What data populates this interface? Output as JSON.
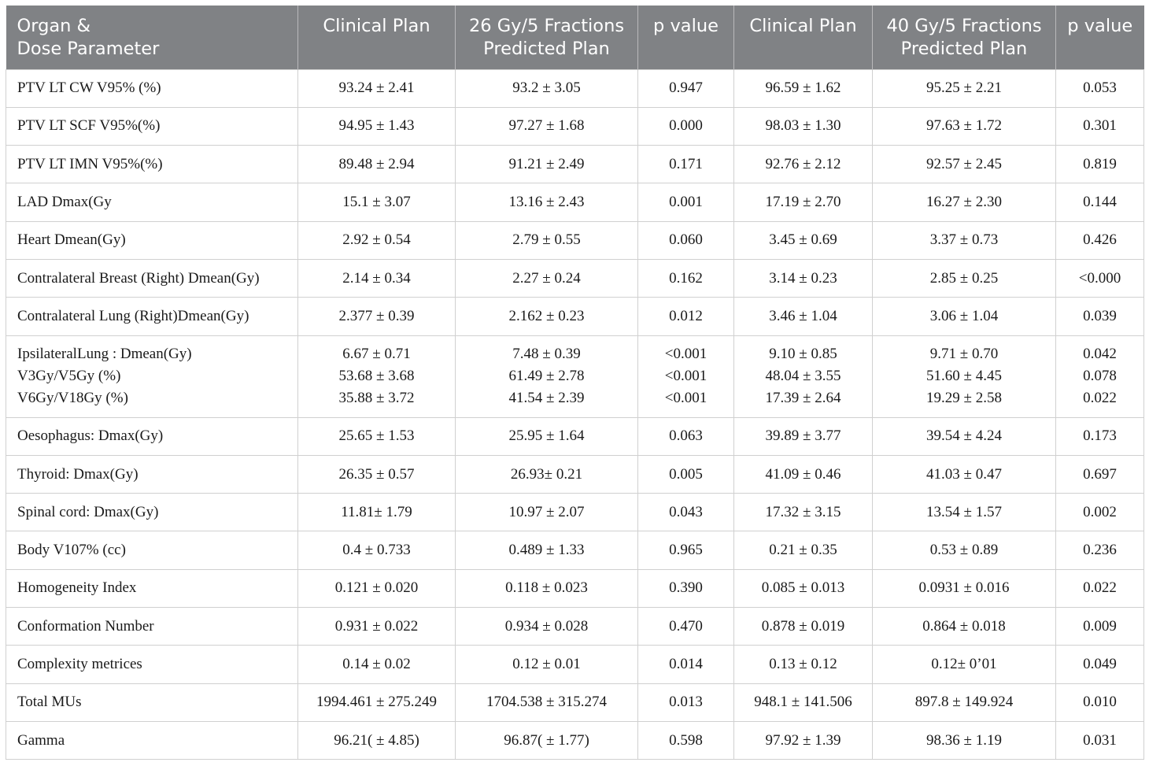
{
  "headers": [
    [
      "Organ &",
      "Dose Parameter"
    ],
    [
      "Clinical Plan"
    ],
    [
      "26 Gy/5 Fractions",
      "Predicted Plan"
    ],
    [
      "p value"
    ],
    [
      "Clinical Plan"
    ],
    [
      "40 Gy/5 Fractions",
      "Predicted Plan"
    ],
    [
      "p value"
    ]
  ],
  "rows": [
    {
      "cells": [
        [
          "PTV LT CW V95% (%)"
        ],
        [
          "93.24 ± 2.41"
        ],
        [
          "93.2 ± 3.05"
        ],
        [
          "0.947"
        ],
        [
          "96.59 ± 1.62"
        ],
        [
          "95.25 ± 2.21"
        ],
        [
          "0.053"
        ]
      ]
    },
    {
      "cells": [
        [
          "PTV LT SCF V95%(%)"
        ],
        [
          "94.95 ± 1.43"
        ],
        [
          "97.27 ± 1.68"
        ],
        [
          "0.000"
        ],
        [
          "98.03 ± 1.30"
        ],
        [
          "97.63 ± 1.72"
        ],
        [
          "0.301"
        ]
      ]
    },
    {
      "cells": [
        [
          "PTV LT IMN V95%(%)"
        ],
        [
          "89.48 ± 2.94"
        ],
        [
          "91.21 ± 2.49"
        ],
        [
          "0.171"
        ],
        [
          "92.76 ± 2.12"
        ],
        [
          "92.57 ± 2.45"
        ],
        [
          "0.819"
        ]
      ]
    },
    {
      "cells": [
        [
          "LAD Dmax(Gy"
        ],
        [
          "15.1 ± 3.07"
        ],
        [
          "13.16 ± 2.43"
        ],
        [
          "0.001"
        ],
        [
          "17.19 ± 2.70"
        ],
        [
          "16.27 ± 2.30"
        ],
        [
          "0.144"
        ]
      ]
    },
    {
      "cells": [
        [
          "Heart Dmean(Gy)"
        ],
        [
          "2.92 ± 0.54"
        ],
        [
          "2.79 ± 0.55"
        ],
        [
          "0.060"
        ],
        [
          "3.45 ± 0.69"
        ],
        [
          "3.37 ± 0.73"
        ],
        [
          "0.426"
        ]
      ]
    },
    {
      "cells": [
        [
          "Contralateral Breast (Right) Dmean(Gy)"
        ],
        [
          "2.14 ± 0.34"
        ],
        [
          "2.27 ± 0.24"
        ],
        [
          "0.162"
        ],
        [
          "3.14 ± 0.23"
        ],
        [
          "2.85 ± 0.25"
        ],
        [
          "<0.000"
        ]
      ]
    },
    {
      "cells": [
        [
          "Contralateral Lung (Right)Dmean(Gy)"
        ],
        [
          "2.377 ± 0.39"
        ],
        [
          "2.162 ± 0.23"
        ],
        [
          "0.012"
        ],
        [
          "3.46 ± 1.04"
        ],
        [
          "3.06 ± 1.04"
        ],
        [
          "0.039"
        ]
      ]
    },
    {
      "cells": [
        [
          "IpsilateralLung : Dmean(Gy)",
          "V3Gy/V5Gy (%)",
          "V6Gy/V18Gy (%)"
        ],
        [
          "6.67 ± 0.71",
          "53.68 ± 3.68",
          "35.88 ± 3.72"
        ],
        [
          "7.48 ± 0.39",
          "61.49 ± 2.78",
          "41.54 ± 2.39"
        ],
        [
          "<0.001",
          "<0.001",
          "<0.001"
        ],
        [
          "9.10 ± 0.85",
          "48.04 ± 3.55",
          "17.39 ± 2.64"
        ],
        [
          "9.71 ± 0.70",
          "51.60 ± 4.45",
          "19.29 ± 2.58"
        ],
        [
          "0.042",
          "0.078",
          "0.022"
        ]
      ]
    },
    {
      "cells": [
        [
          "Oesophagus: Dmax(Gy)"
        ],
        [
          "25.65 ± 1.53"
        ],
        [
          "25.95 ± 1.64"
        ],
        [
          "0.063"
        ],
        [
          "39.89 ± 3.77"
        ],
        [
          "39.54 ± 4.24"
        ],
        [
          "0.173"
        ]
      ]
    },
    {
      "cells": [
        [
          "Thyroid: Dmax(Gy)"
        ],
        [
          "26.35 ± 0.57"
        ],
        [
          "26.93± 0.21"
        ],
        [
          "0.005"
        ],
        [
          "41.09 ± 0.46"
        ],
        [
          "41.03 ± 0.47"
        ],
        [
          "0.697"
        ]
      ]
    },
    {
      "cells": [
        [
          "Spinal cord: Dmax(Gy)"
        ],
        [
          "11.81± 1.79"
        ],
        [
          "10.97 ± 2.07"
        ],
        [
          "0.043"
        ],
        [
          "17.32 ± 3.15"
        ],
        [
          "13.54 ± 1.57"
        ],
        [
          "0.002"
        ]
      ]
    },
    {
      "cells": [
        [
          "Body V107% (cc)"
        ],
        [
          "0.4 ± 0.733"
        ],
        [
          "0.489 ± 1.33"
        ],
        [
          "0.965"
        ],
        [
          "0.21 ± 0.35"
        ],
        [
          "0.53 ± 0.89"
        ],
        [
          "0.236"
        ]
      ]
    },
    {
      "cells": [
        [
          "Homogeneity Index"
        ],
        [
          "0.121 ± 0.020"
        ],
        [
          "0.118 ± 0.023"
        ],
        [
          "0.390"
        ],
        [
          "0.085 ± 0.013"
        ],
        [
          "0.0931 ± 0.016"
        ],
        [
          "0.022"
        ]
      ]
    },
    {
      "cells": [
        [
          "Conformation Number"
        ],
        [
          "0.931 ± 0.022"
        ],
        [
          "0.934 ± 0.028"
        ],
        [
          "0.470"
        ],
        [
          "0.878 ± 0.019"
        ],
        [
          "0.864 ± 0.018"
        ],
        [
          "0.009"
        ]
      ]
    },
    {
      "cells": [
        [
          "Complexity metrices"
        ],
        [
          "0.14 ± 0.02"
        ],
        [
          "0.12 ± 0.01"
        ],
        [
          "0.014"
        ],
        [
          "0.13 ± 0.12"
        ],
        [
          "0.12± 0’01"
        ],
        [
          "0.049"
        ]
      ]
    },
    {
      "cells": [
        [
          "Total MUs"
        ],
        [
          "1994.461 ± 275.249"
        ],
        [
          "1704.538 ± 315.274"
        ],
        [
          "0.013"
        ],
        [
          "948.1 ± 141.506"
        ],
        [
          "897.8 ± 149.924"
        ],
        [
          "0.010"
        ]
      ]
    },
    {
      "cells": [
        [
          "Gamma"
        ],
        [
          "96.21( ± 4.85)"
        ],
        [
          "96.87( ± 1.77)"
        ],
        [
          "0.598"
        ],
        [
          "97.92 ± 1.39"
        ],
        [
          "98.36 ± 1.19"
        ],
        [
          "0.031"
        ]
      ]
    }
  ]
}
